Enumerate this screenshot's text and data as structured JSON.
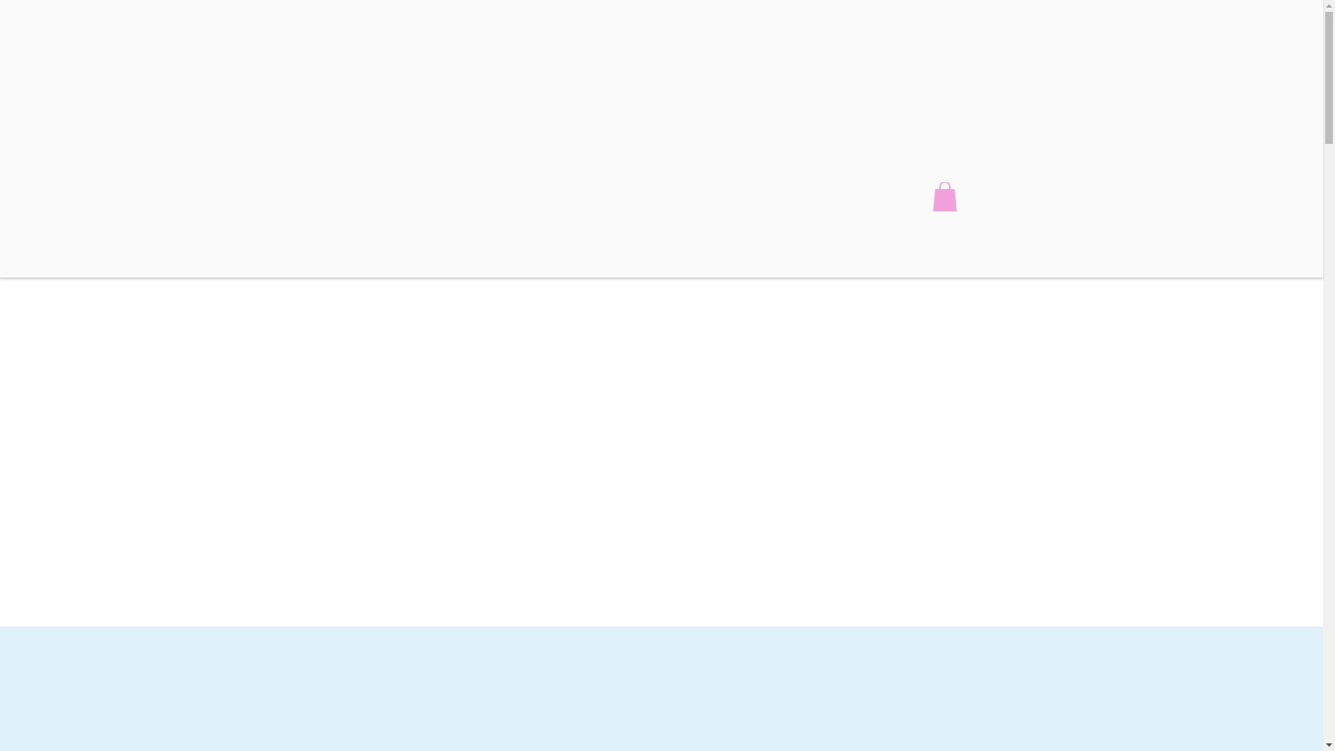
{
  "header": {
    "cart": {
      "kind": "bag"
    }
  }
}
